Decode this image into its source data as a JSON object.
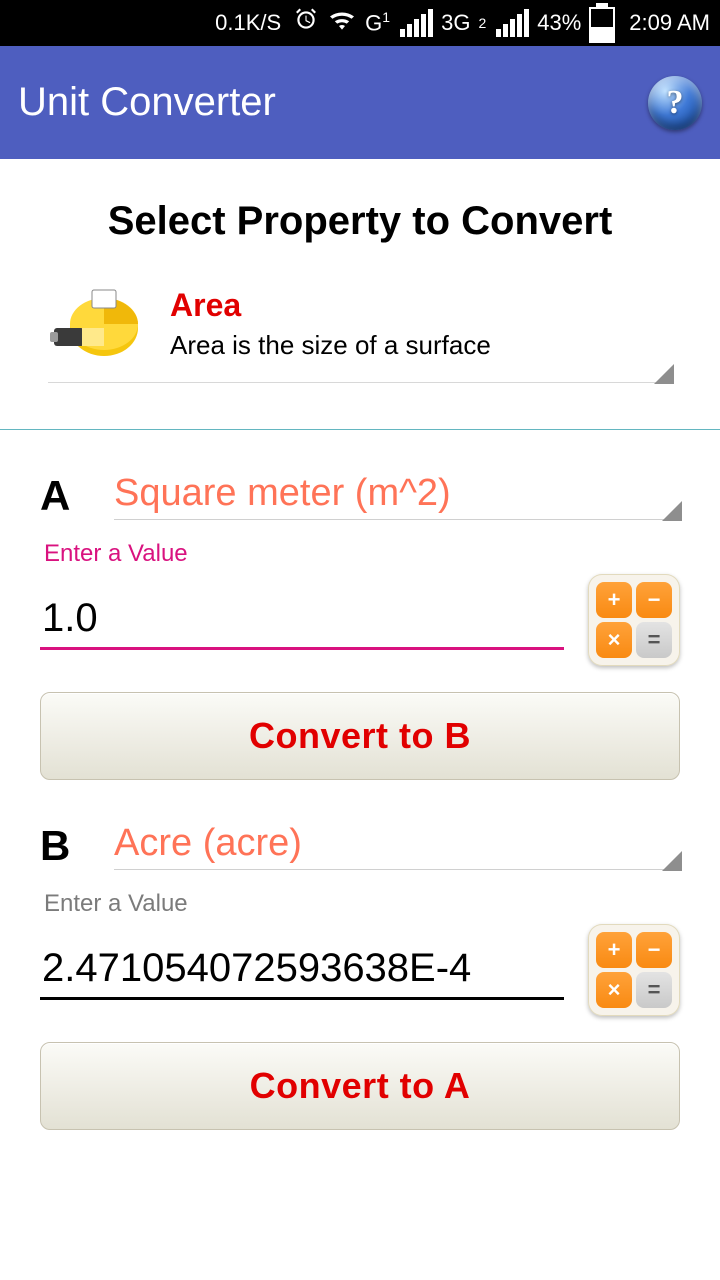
{
  "status": {
    "speed": "0.1K/S",
    "network_label": "3G",
    "battery_pct": "43%",
    "time": "2:09 AM",
    "g1": "G",
    "g1_sup": "1",
    "g2_sup": "2"
  },
  "app": {
    "title": "Unit Converter",
    "help_glyph": "?"
  },
  "section_title": "Select Property to Convert",
  "property": {
    "name": "Area",
    "description": "Area is the size of a surface"
  },
  "a": {
    "letter": "A",
    "unit": "Square meter (m^2)",
    "enter_label": "Enter a Value",
    "value": "1.0",
    "convert_label": "Convert to B"
  },
  "b": {
    "letter": "B",
    "unit": "Acre (acre)",
    "enter_label": "Enter a Value",
    "value": "2.471054072593638E-4",
    "convert_label": "Convert to A"
  },
  "calc": {
    "plus": "+",
    "minus": "−",
    "times": "×",
    "equals": "="
  }
}
